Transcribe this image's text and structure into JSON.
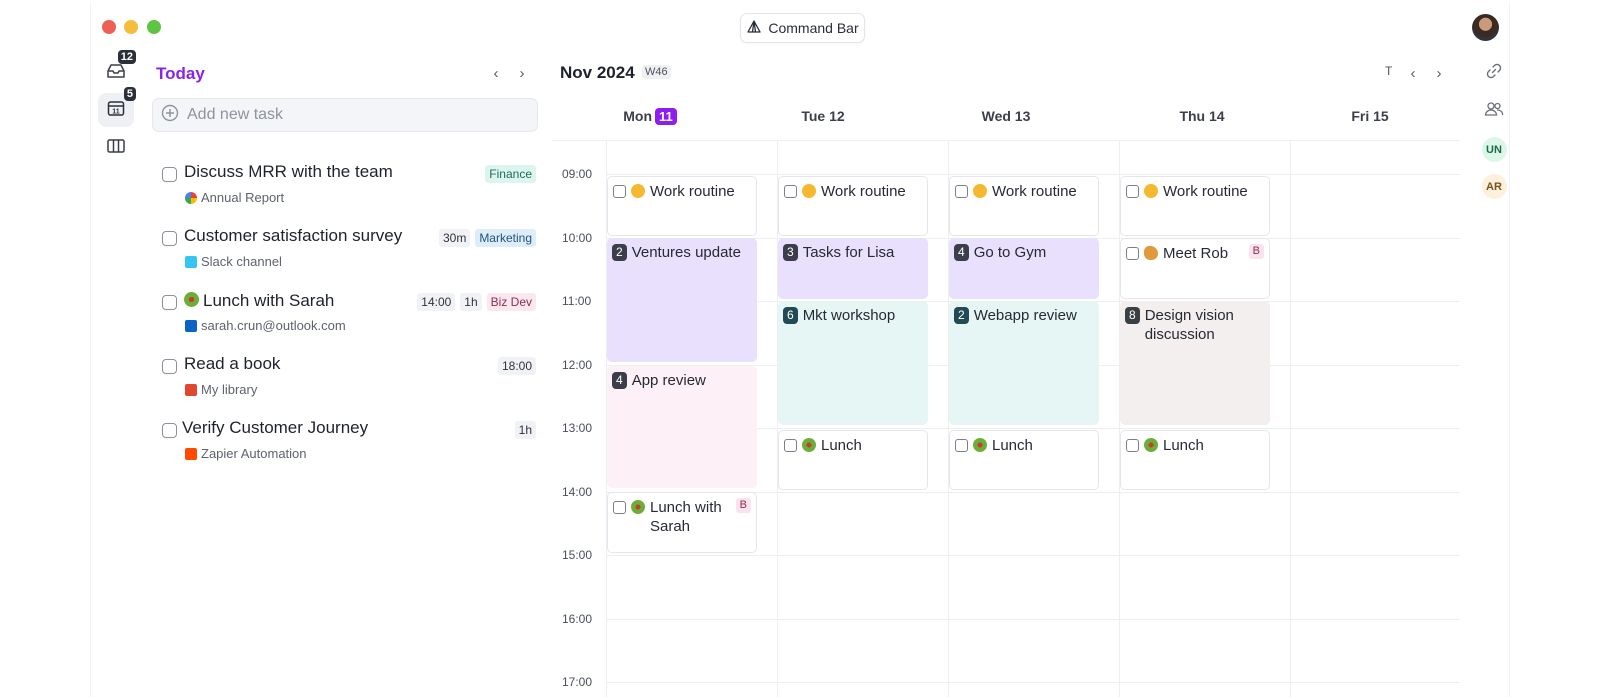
{
  "command_bar": {
    "label": "Command Bar"
  },
  "rail": {
    "inbox_count": "12",
    "calendar_count": "5",
    "calendar_day": "11"
  },
  "today": {
    "title": "Today",
    "add_placeholder": "Add new task",
    "tasks": [
      {
        "title": "Discuss MRR with the team",
        "source": "Annual Report",
        "source_icon": "google-icon",
        "tags": [
          "Finance"
        ]
      },
      {
        "title": "Customer satisfaction survey",
        "source": "Slack channel",
        "source_icon": "slack-icon",
        "tags": [
          "30m",
          "Marketing"
        ]
      },
      {
        "title": "Lunch with Sarah",
        "source": "sarah.crun@outlook.com",
        "source_icon": "outlook-icon",
        "tags": [
          "14:00",
          "1h",
          "Biz Dev"
        ]
      },
      {
        "title": "Read a book",
        "source": "My library",
        "source_icon": "library-icon",
        "tags": [
          "18:00"
        ]
      },
      {
        "title": "Verify Customer Journey",
        "source": "Zapier Automation",
        "source_icon": "zapier-icon",
        "tags": [
          "1h"
        ]
      }
    ]
  },
  "calendar": {
    "title": "Nov 2024",
    "week": "W46",
    "today_btn": "T",
    "days": [
      {
        "name": "Mon",
        "num": "11",
        "today": true
      },
      {
        "name": "Tue 12"
      },
      {
        "name": "Wed 13"
      },
      {
        "name": "Thu 14"
      },
      {
        "name": "Fri 15"
      }
    ],
    "times": [
      "09:00",
      "10:00",
      "11:00",
      "12:00",
      "13:00",
      "14:00",
      "15:00",
      "16:00",
      "17:00"
    ],
    "events": {
      "mon_work": "Work routine",
      "tue_work": "Work routine",
      "wed_work": "Work routine",
      "thu_work": "Work routine",
      "mon_ventures": {
        "count": "2",
        "title": "Ventures update"
      },
      "tue_tasks": {
        "count": "3",
        "title": "Tasks for Lisa"
      },
      "wed_gym": {
        "count": "4",
        "title": "Go to Gym"
      },
      "thu_rob": {
        "title": "Meet Rob",
        "badge": "B"
      },
      "tue_mkt": {
        "count": "6",
        "title": "Mkt workshop"
      },
      "wed_webapp": {
        "count": "2",
        "title": "Webapp review"
      },
      "thu_design": {
        "count": "8",
        "title": "Design vision discussion"
      },
      "mon_app": {
        "count": "4",
        "title": "App review"
      },
      "tue_lunch": "Lunch",
      "wed_lunch": "Lunch",
      "thu_lunch": "Lunch",
      "mon_lunch": {
        "title": "Lunch with Sarah",
        "badge": "B"
      }
    }
  },
  "right_rail": {
    "user1": "UN",
    "user2": "AR"
  },
  "colors": {
    "accent": "#8e1ef0",
    "today_title": "#8b22e8"
  }
}
